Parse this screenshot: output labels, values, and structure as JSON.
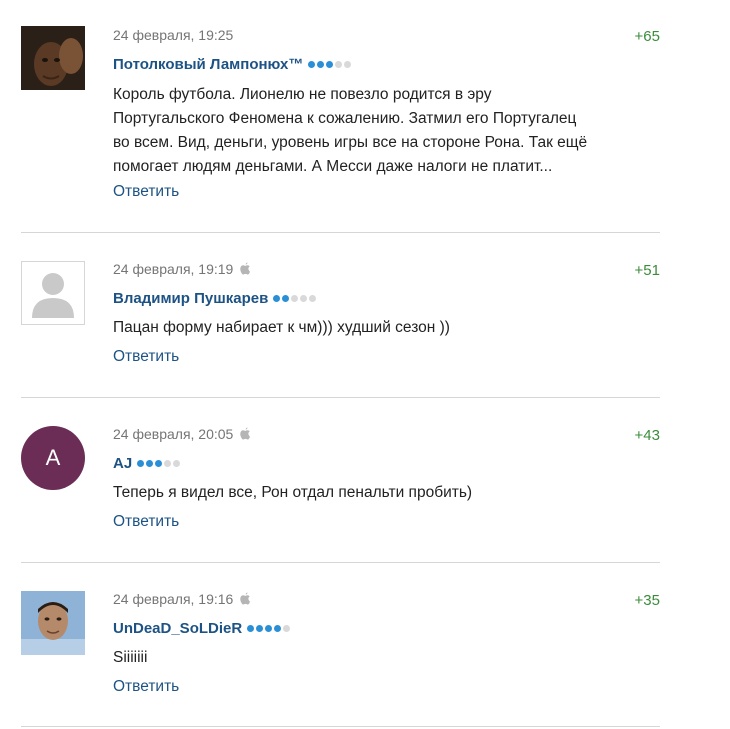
{
  "comments": [
    {
      "date": "24 февраля, 19:25",
      "author": "Потолковый Лампонюх™",
      "rating_dots_on": 3,
      "rating_dots_total": 5,
      "score": "+65",
      "has_apple": false,
      "avatar": "photo",
      "text": [
        "Король футбола. Лионелю не повезло родится в эру",
        "Португальского Феномена к сожалению. Затмил его Португалец",
        "во всем. Вид, деньги, уровень игры все на стороне Рона. Так ещё",
        "помогает людям деньгами. А Месси даже налоги не платит..."
      ],
      "reply_label": "Ответить"
    },
    {
      "date": "24 февраля, 19:19",
      "author": "Владимир Пушкарев",
      "rating_dots_on": 2,
      "rating_dots_total": 5,
      "score": "+51",
      "has_apple": true,
      "avatar": "placeholder",
      "text": [
        "Пацан форму набирает к чм))) худший сезон ))"
      ],
      "reply_label": "Ответить"
    },
    {
      "date": "24 февраля, 20:05",
      "author": "AJ",
      "rating_dots_on": 3,
      "rating_dots_total": 5,
      "score": "+43",
      "has_apple": true,
      "avatar": "letter",
      "avatar_letter": "A",
      "text": [
        "Теперь я видел все, Рон отдал пенальти пробить)"
      ],
      "reply_label": "Ответить"
    },
    {
      "date": "24 февраля, 19:16",
      "author": "UnDeaD_SoLDieR",
      "rating_dots_on": 4,
      "rating_dots_total": 5,
      "score": "+35",
      "has_apple": true,
      "avatar": "photo",
      "text": [
        "Siiiiiii"
      ],
      "reply_label": "Ответить"
    }
  ],
  "colors": {
    "author": "#1d5384",
    "score": "#3a8c3a",
    "dot_on": "#2b8fd6",
    "dot_off": "#d9d9d9",
    "avatar_letter_bg": "#6b2d56"
  }
}
